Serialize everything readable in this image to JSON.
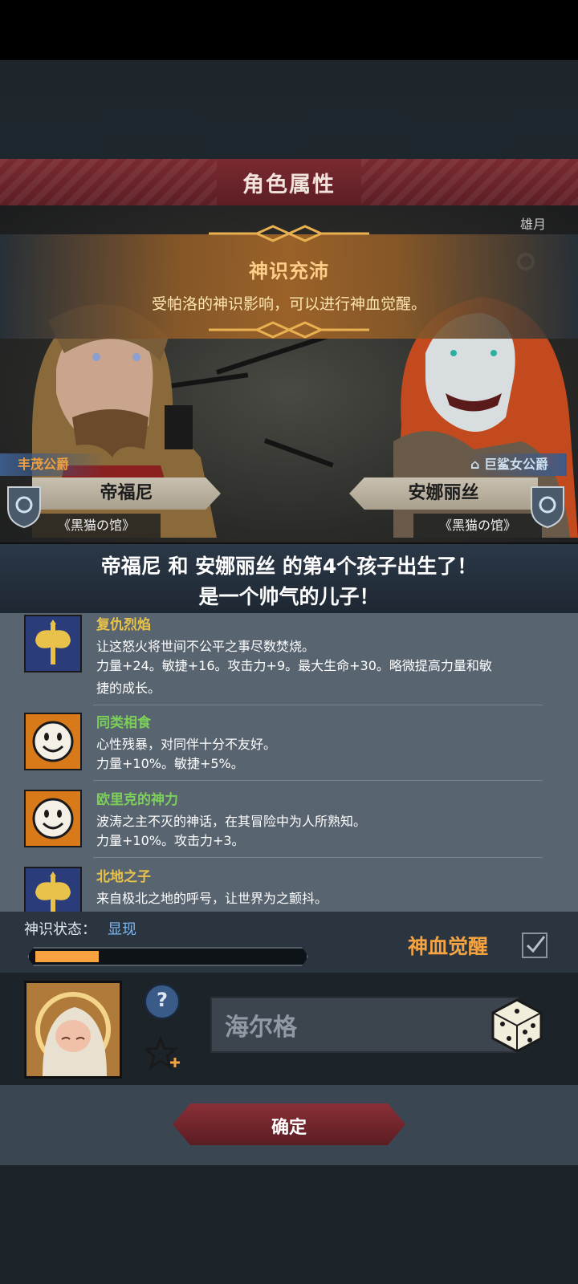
{
  "title": "角色属性",
  "banner": {
    "title": "神识充沛",
    "subtitle": "受帕洛的神识影响，可以进行神血觉醒。"
  },
  "father": {
    "rank": "丰茂公爵",
    "name": "帝福尼",
    "house": "《黑猫の馆》"
  },
  "mother": {
    "rank": "巨鲨女公爵",
    "name": "安娜丽丝",
    "house": "《黑猫の馆》"
  },
  "corner_text": "雄月",
  "announcement": {
    "line1": "帝福尼 和 安娜丽丝 的第4个孩子出生了！",
    "line2": "是一个帅气的儿子！"
  },
  "traits": [
    {
      "name": "复仇烈焰",
      "name_color": "#e8c24a",
      "icon": "axe-icon",
      "desc": "让这怒火将世间不公平之事尽数焚烧。",
      "effect_1": "力量+24。敏捷+16。攻击力+9。最大生命+30。略微提高力量和敏",
      "effect_2": "捷的成长。"
    },
    {
      "name": "同类相食",
      "name_color": "#7cd05a",
      "icon": "smiley-icon",
      "desc": "心性残暴，对同伴十分不友好。",
      "effect_1": "力量+10%。敏捷+5%。"
    },
    {
      "name": "欧里克的神力",
      "name_color": "#7cd05a",
      "icon": "smiley-icon",
      "desc": "波涛之主不灭的神话，在其冒险中为人所熟知。",
      "effect_1": "力量+10%。攻击力+3。"
    },
    {
      "name": "北地之子",
      "name_color": "#e8c24a",
      "icon": "axe-icon",
      "desc": "来自极北之地的呼号，让世界为之颤抖。"
    }
  ],
  "status": {
    "label": "神识状态：",
    "value": "显现",
    "progress": 0.24,
    "awaken_label": "神血觉醒"
  },
  "child": {
    "name": "海尔格",
    "help_symbol": "?"
  },
  "confirm_label": "确定",
  "colors": {
    "accent_orange": "#f6a340",
    "title_red": "#7a2a31",
    "trait_gold": "#e8c24a",
    "trait_green": "#7cd05a",
    "status_blue": "#7fb6f0"
  }
}
